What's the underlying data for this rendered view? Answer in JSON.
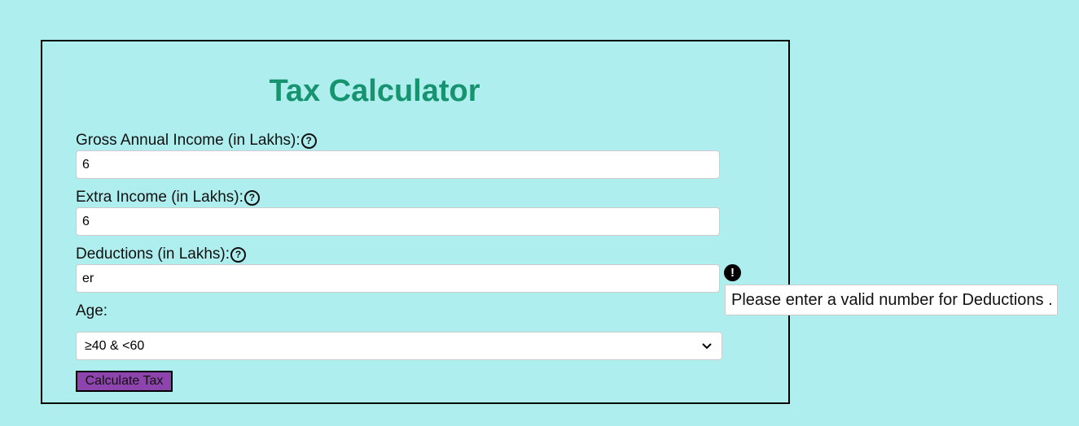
{
  "form": {
    "title": "Tax Calculator",
    "gross_income": {
      "label": "Gross Annual Income (in Lakhs):",
      "value": "6",
      "help_icon": "question-circle-icon"
    },
    "extra_income": {
      "label": "Extra Income (in Lakhs):",
      "value": "6",
      "help_icon": "question-circle-icon"
    },
    "deductions": {
      "label": "Deductions (in Lakhs):",
      "value": "er",
      "help_icon": "question-circle-icon",
      "error_icon": "exclamation-circle-icon",
      "error_message": "Please enter a valid number for Deductions ."
    },
    "age": {
      "label": "Age:",
      "selected": "≥40 & <60"
    },
    "submit_label": "Calculate Tax"
  },
  "colors": {
    "background": "#afeeee",
    "title": "#16936f",
    "button": "#8e44ad"
  }
}
